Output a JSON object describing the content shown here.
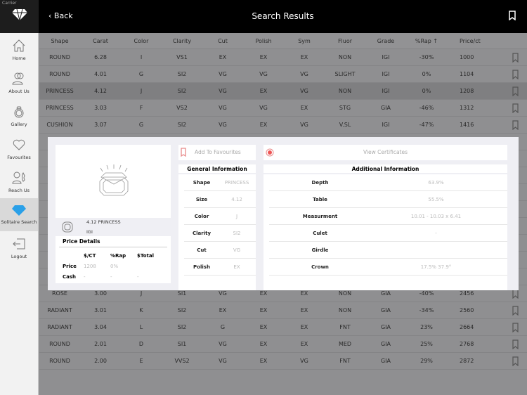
{
  "status_bar": {
    "carrier": "Carrier"
  },
  "header": {
    "back": "Back",
    "title": "Search Results"
  },
  "sidebar": [
    {
      "label": "Home"
    },
    {
      "label": "About Us"
    },
    {
      "label": "Gallery"
    },
    {
      "label": "Favourites"
    },
    {
      "label": "Reach Us"
    },
    {
      "label": "Solitaire Search"
    },
    {
      "label": "Logout"
    }
  ],
  "table": {
    "columns": [
      "Shape",
      "Carat",
      "Color",
      "Clarity",
      "Cut",
      "Polish",
      "Sym",
      "Fluor",
      "Grade",
      "%Rap ↑",
      "Price/ct"
    ],
    "rows_top": [
      [
        "ROUND",
        "6.28",
        "I",
        "VS1",
        "EX",
        "EX",
        "EX",
        "NON",
        "IGI",
        "-30%",
        "1000"
      ],
      [
        "ROUND",
        "4.01",
        "G",
        "SI2",
        "VG",
        "VG",
        "VG",
        "SLIGHT",
        "IGI",
        "0%",
        "1104"
      ],
      [
        "PRINCESS",
        "4.12",
        "J",
        "SI2",
        "VG",
        "EX",
        "VG",
        "NON",
        "IGI",
        "0%",
        "1208"
      ],
      [
        "PRINCESS",
        "3.03",
        "F",
        "VS2",
        "VG",
        "VG",
        "EX",
        "STG",
        "GIA",
        "-46%",
        "1312"
      ],
      [
        "CUSHION",
        "3.07",
        "G",
        "SI2",
        "VG",
        "EX",
        "VG",
        "V.SL",
        "IGI",
        "-47%",
        "1416"
      ]
    ],
    "rows_bottom": [
      [
        "ROSE",
        "3.00",
        "J",
        "SI1",
        "VG",
        "EX",
        "EX",
        "NON",
        "GIA",
        "-40%",
        "2456"
      ],
      [
        "RADIANT",
        "3.01",
        "K",
        "SI2",
        "EX",
        "EX",
        "EX",
        "NON",
        "GIA",
        "-34%",
        "2560"
      ],
      [
        "RADIANT",
        "3.04",
        "L",
        "SI2",
        "G",
        "EX",
        "EX",
        "FNT",
        "GIA",
        "23%",
        "2664"
      ],
      [
        "ROUND",
        "2.01",
        "D",
        "SI1",
        "VG",
        "EX",
        "EX",
        "MED",
        "GIA",
        "25%",
        "2768"
      ],
      [
        "ROUND",
        "2.00",
        "E",
        "VVS2",
        "VG",
        "EX",
        "VG",
        "FNT",
        "GIA",
        "29%",
        "2872"
      ]
    ]
  },
  "detail": {
    "title": "4.12 PRINCESS",
    "lab": "IGI",
    "add_favourites": "Add To Favourites",
    "view_certificates": "View Certificates",
    "price": {
      "heading": "Price Details",
      "cols": [
        "$/CT",
        "%Rap",
        "$Total"
      ],
      "price_label": "Price",
      "price": [
        "1208",
        "0%",
        ""
      ],
      "cash_label": "Cash",
      "cash": [
        "-",
        "-",
        "-"
      ]
    },
    "general": {
      "heading": "General Information",
      "rows": [
        [
          "Shape",
          "PRINCESS"
        ],
        [
          "Size",
          "4.12"
        ],
        [
          "Color",
          "J"
        ],
        [
          "Clarity",
          "SI2"
        ],
        [
          "Cut",
          "VG"
        ],
        [
          "Polish",
          "EX"
        ]
      ]
    },
    "additional": {
      "heading": "Additional Information",
      "rows": [
        [
          "Depth",
          "63.9%"
        ],
        [
          "Table",
          "55.5%"
        ],
        [
          "Measurment",
          "10.01 - 10.03 x 6.41"
        ],
        [
          "Culet",
          "-"
        ],
        [
          "Girdle",
          ""
        ],
        [
          "Crown",
          "17.5% 37.9°"
        ]
      ]
    }
  },
  "colors": {
    "accent": "#2aa0e8",
    "fav": "#e88a8a"
  }
}
